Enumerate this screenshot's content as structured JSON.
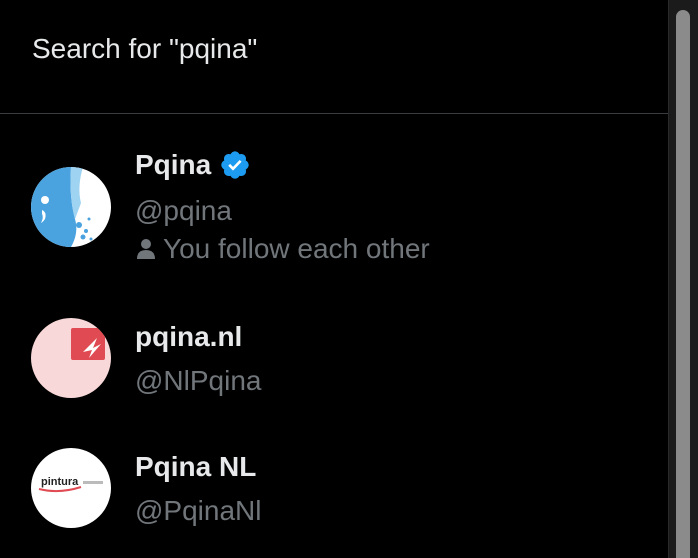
{
  "search": {
    "label": "Search for \"pqina\""
  },
  "results": [
    {
      "name": "Pqina",
      "handle": "@pqina",
      "verified": true,
      "follow_text": "You follow each other"
    },
    {
      "name": "pqina.nl",
      "handle": "@NlPqina",
      "verified": false
    },
    {
      "name": "Pqina NL",
      "handle": "@PqinaNl",
      "verified": false,
      "avatar_text": "pintura"
    }
  ],
  "colors": {
    "background": "#000000",
    "primary_text": "#e7e9ea",
    "secondary_text": "#71767b",
    "verified_blue": "#1d9bf0",
    "divider": "#3a3d40"
  }
}
